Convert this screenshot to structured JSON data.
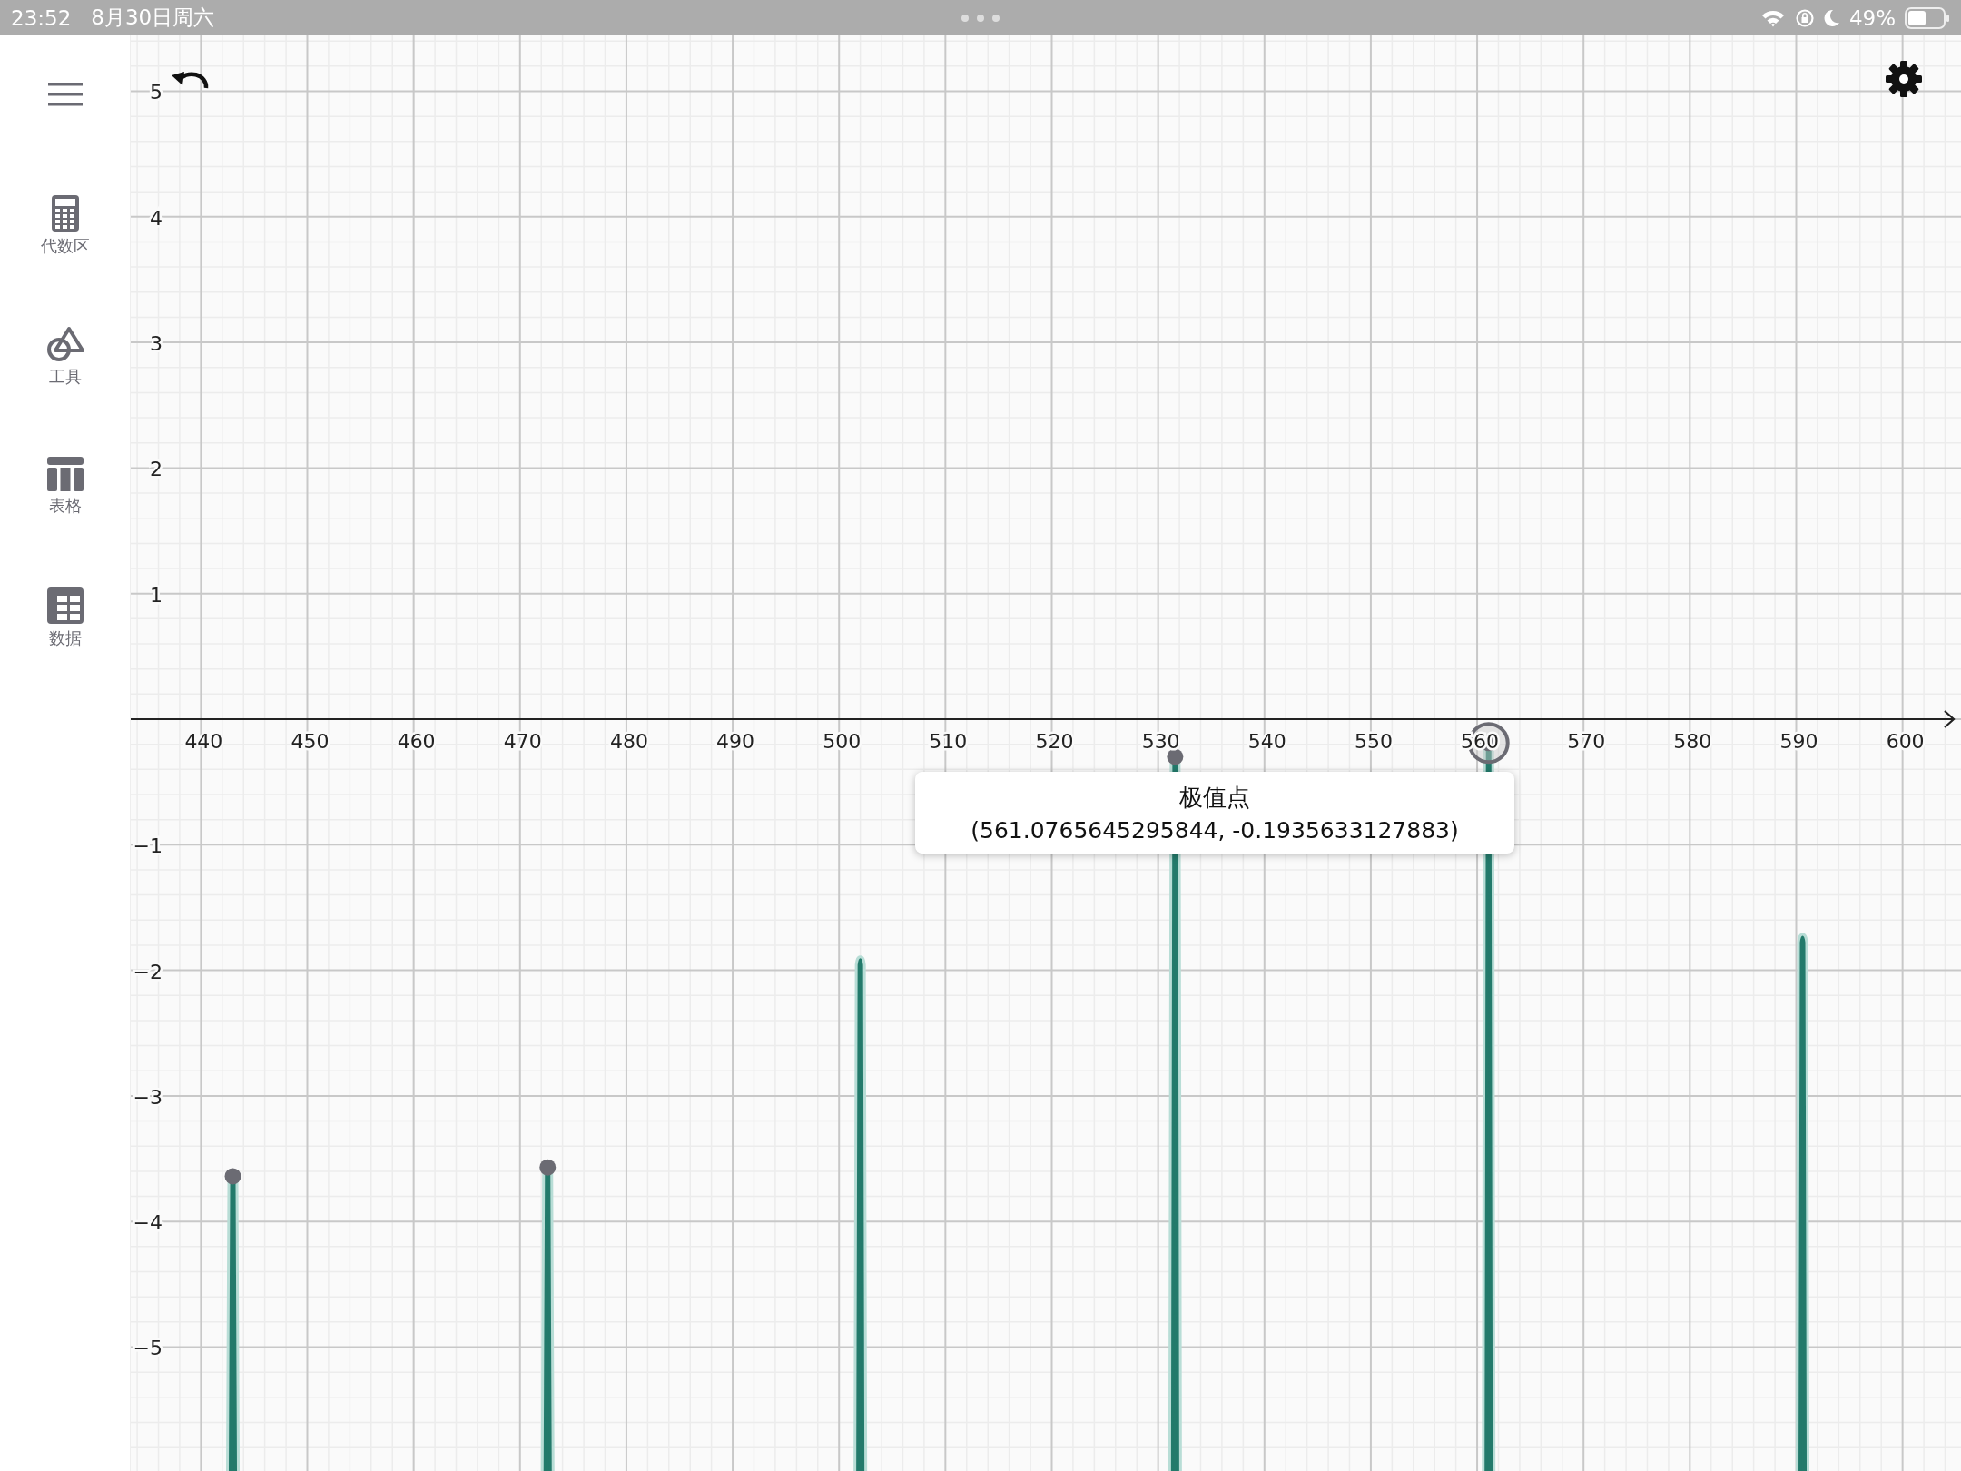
{
  "status_bar": {
    "time": "23:52",
    "date": "8月30日周六",
    "battery": "49%"
  },
  "sidebar": {
    "items": [
      {
        "label": "代数区",
        "kind": "algebra"
      },
      {
        "label": "工具",
        "kind": "tools"
      },
      {
        "label": "表格",
        "kind": "table"
      },
      {
        "label": "数据",
        "kind": "data"
      }
    ]
  },
  "graph": {
    "x_ticks": [
      "440",
      "450",
      "460",
      "470",
      "480",
      "490",
      "500",
      "510",
      "520",
      "530",
      "540",
      "550",
      "560",
      "570",
      "580",
      "590",
      "600"
    ],
    "y_ticks": [
      "5",
      "4",
      "3",
      "2",
      "1",
      "−1",
      "−2",
      "−3",
      "−4",
      "−5"
    ]
  },
  "tooltip": {
    "title": "极值点",
    "coordinates": "(561.0765645295844, -0.1935633127883)"
  }
}
